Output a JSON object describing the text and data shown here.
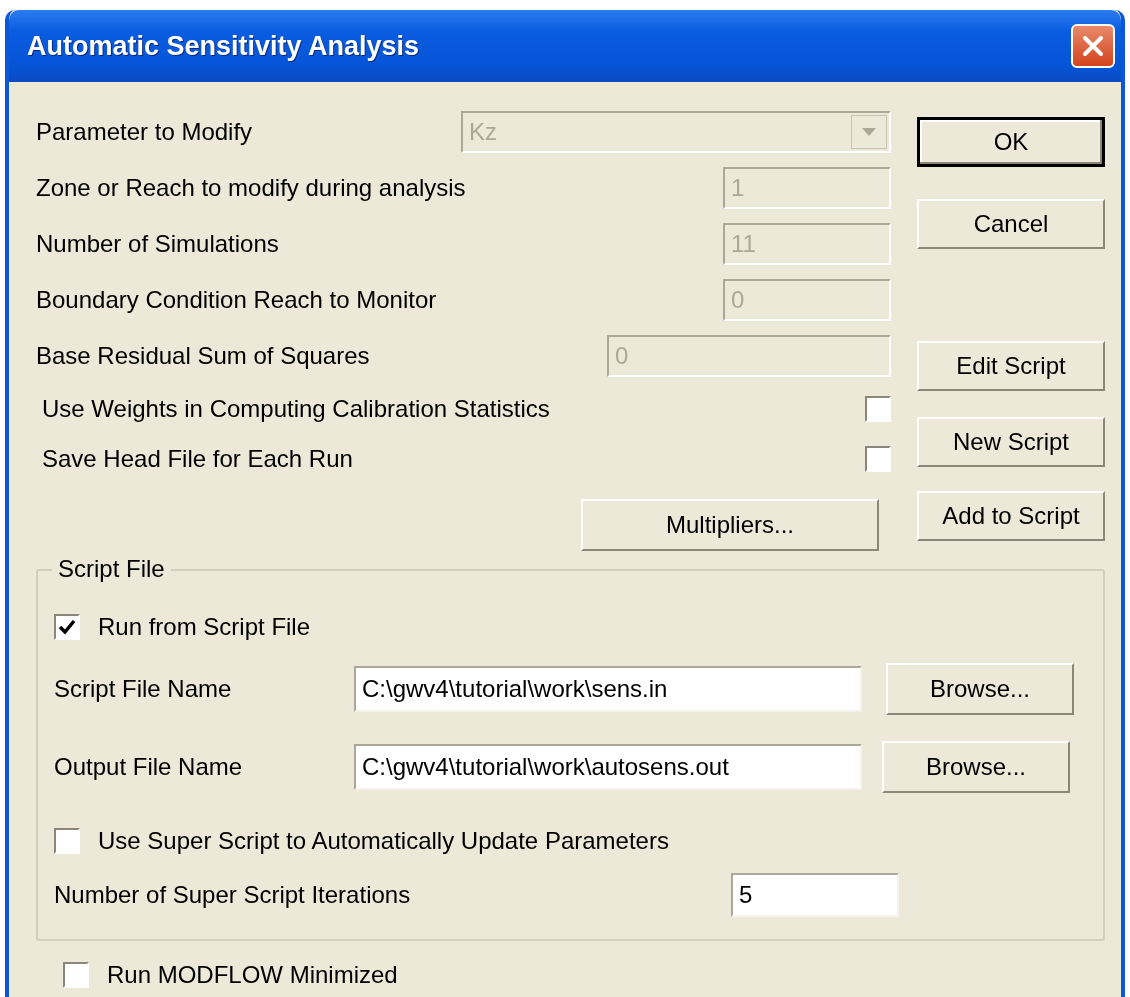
{
  "window": {
    "title": "Automatic Sensitivity Analysis"
  },
  "parameters": [
    {
      "kind": "combo",
      "label": "Parameter to Modify",
      "value": "Kz",
      "disabled": true
    },
    {
      "kind": "text",
      "label": "Zone or Reach to modify during analysis",
      "value": "1",
      "disabled": true
    },
    {
      "kind": "text",
      "label": "Number of Simulations",
      "value": "11",
      "disabled": true
    },
    {
      "kind": "text",
      "label": "Boundary Condition Reach to Monitor",
      "value": "0",
      "disabled": true
    },
    {
      "kind": "text",
      "label": "Base Residual Sum of Squares",
      "value": "0",
      "disabled": true
    }
  ],
  "options": [
    {
      "label": "Use Weights in Computing Calibration Statistics",
      "checked": false
    },
    {
      "label": "Save Head File for Each Run",
      "checked": false
    }
  ],
  "multipliers_button": "Multipliers...",
  "buttons": [
    {
      "label": "OK",
      "default": true
    },
    {
      "label": "Cancel",
      "default": false
    },
    {
      "label": "Edit Script",
      "default": false
    },
    {
      "label": "New Script",
      "default": false
    },
    {
      "label": "Add to Script",
      "default": false
    }
  ],
  "script_file": {
    "title": "Script File",
    "run_from_script": {
      "label": "Run from Script File",
      "checked": true
    },
    "files": [
      {
        "label": "Script File Name",
        "value": "C:\\gwv4\\tutorial\\work\\sens.in",
        "button": "Browse..."
      },
      {
        "label": "Output File Name",
        "value": "C:\\gwv4\\tutorial\\work\\autosens.out",
        "button": "Browse..."
      }
    ],
    "super_script": {
      "label": "Use Super Script to Automatically Update Parameters",
      "checked": false
    },
    "iterations": {
      "label": "Number of Super Script Iterations",
      "value": "5"
    }
  },
  "run_minimized": {
    "label": "Run MODFLOW Minimized",
    "checked": false
  }
}
